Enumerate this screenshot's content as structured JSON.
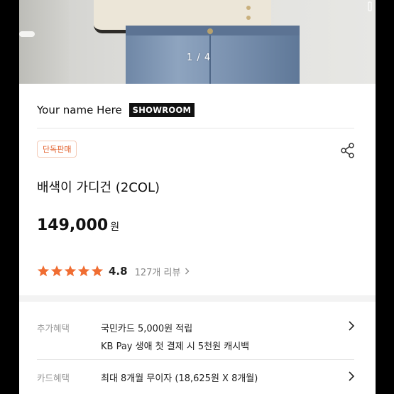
{
  "photo": {
    "pager": "1 / 4"
  },
  "brand": {
    "name": "Your name Here",
    "badge": "SHOWROOM"
  },
  "product": {
    "tag": "단독판매",
    "title": "배색이 가디건 (2COL)",
    "price": "149,000",
    "price_unit": "원"
  },
  "rating": {
    "stars": 5,
    "star_color": "#f06d32",
    "score": "4.8",
    "review_text": "127개 리뷰"
  },
  "benefits": [
    {
      "label": "추가혜택",
      "lines": [
        "국민카드 5,000원 적립",
        "KB Pay 생애 첫 결제 시 5천원 캐시백"
      ]
    },
    {
      "label": "카드혜택",
      "lines": [
        "최대 8개월 무이자 (18,625원 X 8개월)"
      ]
    }
  ],
  "icons": {
    "share": "share-icon",
    "chevron": "chevron-right-icon",
    "star": "star-icon"
  }
}
